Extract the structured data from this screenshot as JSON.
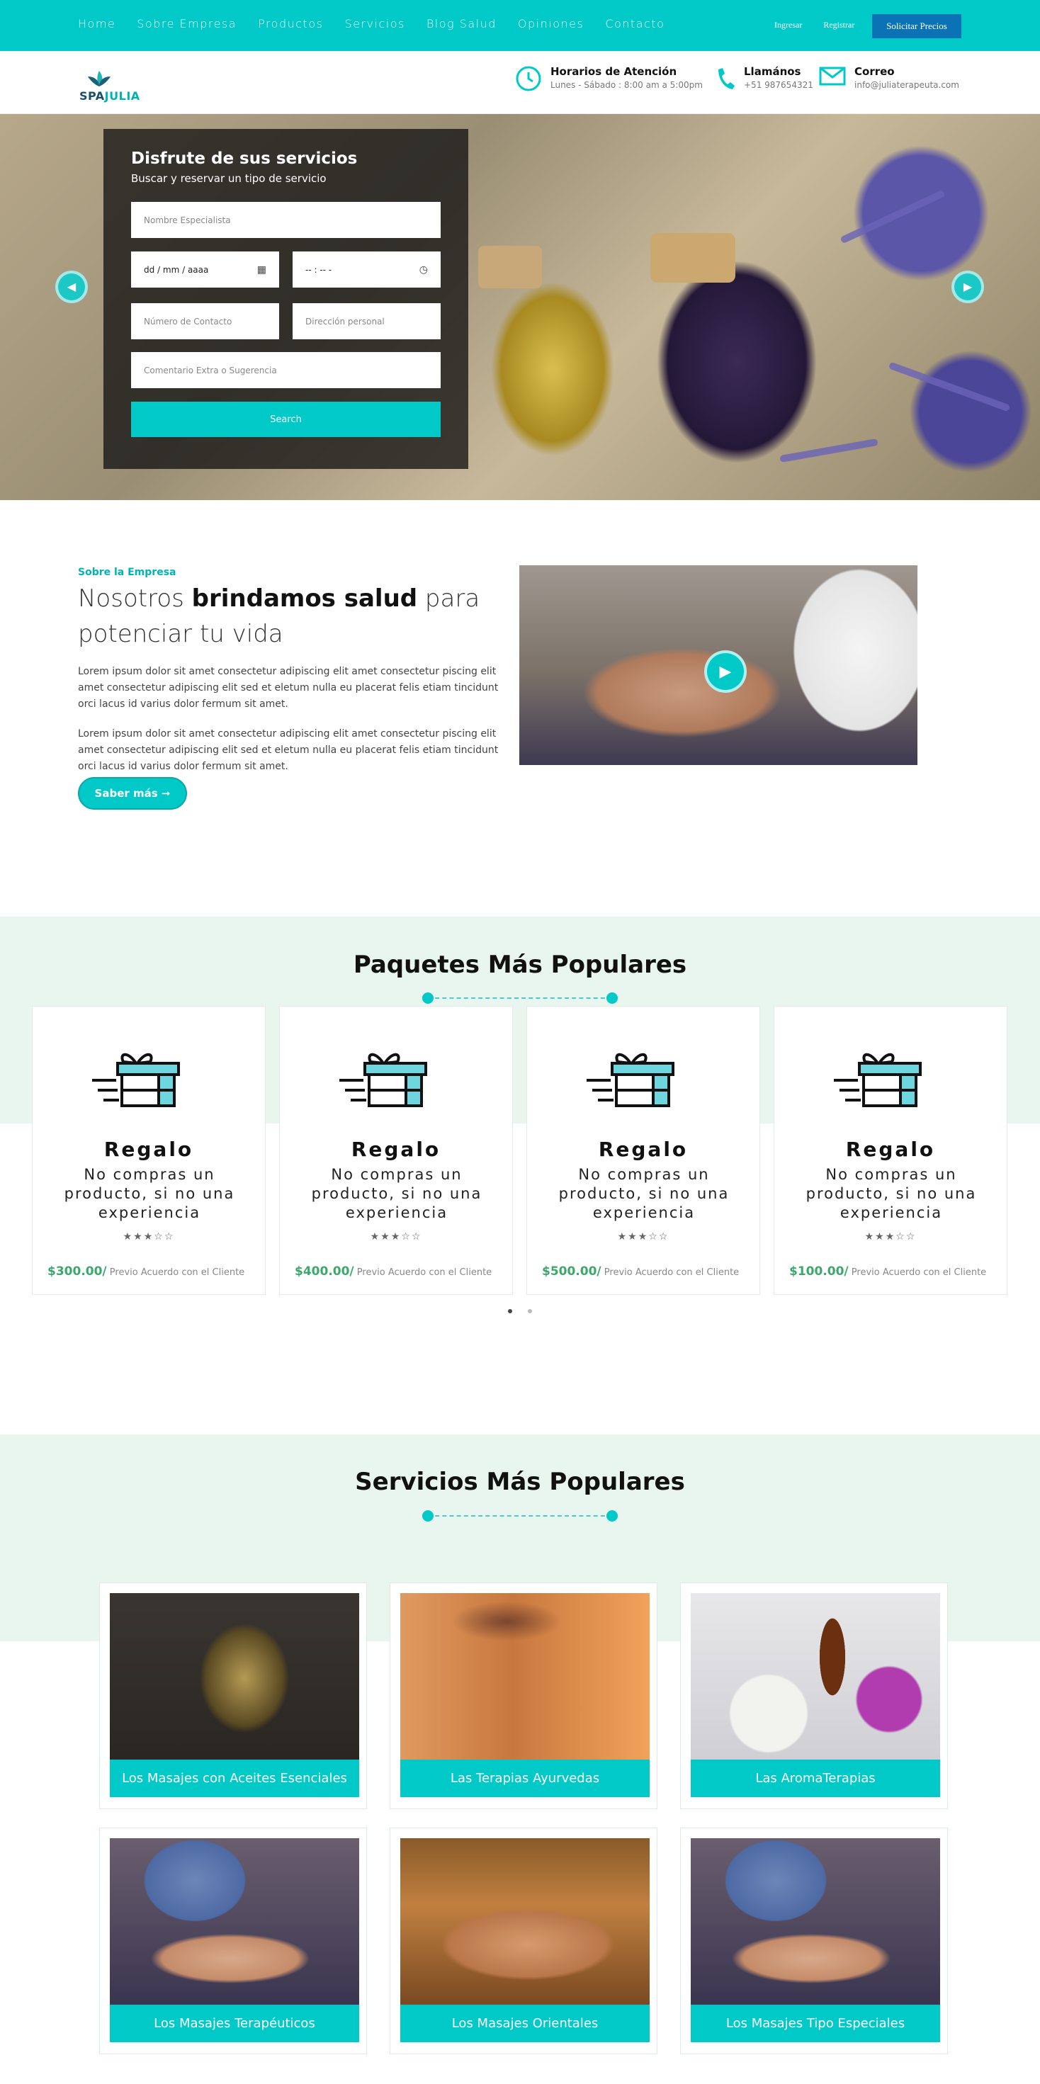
{
  "nav": {
    "items": [
      "Home",
      "Sobre Empresa",
      "Productos",
      "Servicios",
      "Blog Salud",
      "Opiniones",
      "Contacto"
    ],
    "login": "Ingresar",
    "register": "Registrar",
    "quote": "Solicitar Precios"
  },
  "brand": {
    "logo_a": "SPA",
    "logo_b": "JULIA"
  },
  "contact": {
    "hours_title": "Horarios de Atención",
    "hours_value": "Lunes - Sábado : 8:00 am a 5:00pm",
    "call_title": "Llamános",
    "call_value": "+51 987654321",
    "mail_title": "Correo",
    "mail_value": "info@juliaterapeuta.com"
  },
  "hero": {
    "title": "Disfrute de sus servicios",
    "subtitle": "Buscar y reservar un tipo de servicio",
    "f_specialist": "Nombre Especialista",
    "f_date": "dd / mm / aaaa",
    "f_time": "-- : -- -",
    "f_phone": "Número de Contacto",
    "f_address": "Dirección personal",
    "f_comment": "Comentario Extra o Sugerencia",
    "search": "Search"
  },
  "about": {
    "tag": "Sobre la Empresa",
    "h1": "Nosotros ",
    "h_bold": "brindamos salud",
    "h2": " para potenciar tu vida",
    "p1": "Lorem ipsum dolor sit amet consectetur adipiscing elit amet consectetur piscing elit amet consectetur adipiscing elit sed et eletum nulla eu placerat felis etiam tincidunt orci lacus id varius dolor fermum sit amet.",
    "p2": "Lorem ipsum dolor sit amet consectetur adipiscing elit amet consectetur piscing elit amet consectetur adipiscing elit sed et eletum nulla eu placerat felis etiam tincidunt orci lacus id varius dolor fermum sit amet.",
    "button": "Saber más ➞"
  },
  "packages": {
    "title": "Paquetes Más Populares",
    "items": [
      {
        "name": "Regalo",
        "desc": "No compras un producto, si no una experiencia",
        "stars": "★★★☆☆",
        "price": "$300.00/",
        "note": " Previo Acuerdo con el Cliente"
      },
      {
        "name": "Regalo",
        "desc": "No compras un producto, si no una experiencia",
        "stars": "★★★☆☆",
        "price": "$400.00/",
        "note": " Previo Acuerdo con el Cliente"
      },
      {
        "name": "Regalo",
        "desc": "No compras un producto, si no una experiencia",
        "stars": "★★★☆☆",
        "price": "$500.00/",
        "note": " Previo Acuerdo con el Cliente"
      },
      {
        "name": "Regalo",
        "desc": "No compras un producto, si no una experiencia",
        "stars": "★★★☆☆",
        "price": "$100.00/",
        "note": " Previo Acuerdo con el Cliente"
      }
    ]
  },
  "services": {
    "title": "Servicios Más Populares",
    "items": [
      "Los Masajes con Aceites Esenciales",
      "Las Terapias Ayurvedas",
      "Las AromaTerapias",
      "Los Masajes Terapéuticos",
      "Los Masajes Orientales",
      "Los Masajes Tipo Especiales"
    ]
  },
  "colors": {
    "accent": "#00c9c8",
    "quote_btn": "#0b73b5",
    "band": "#e9f6ef",
    "price": "#3ca86b"
  }
}
